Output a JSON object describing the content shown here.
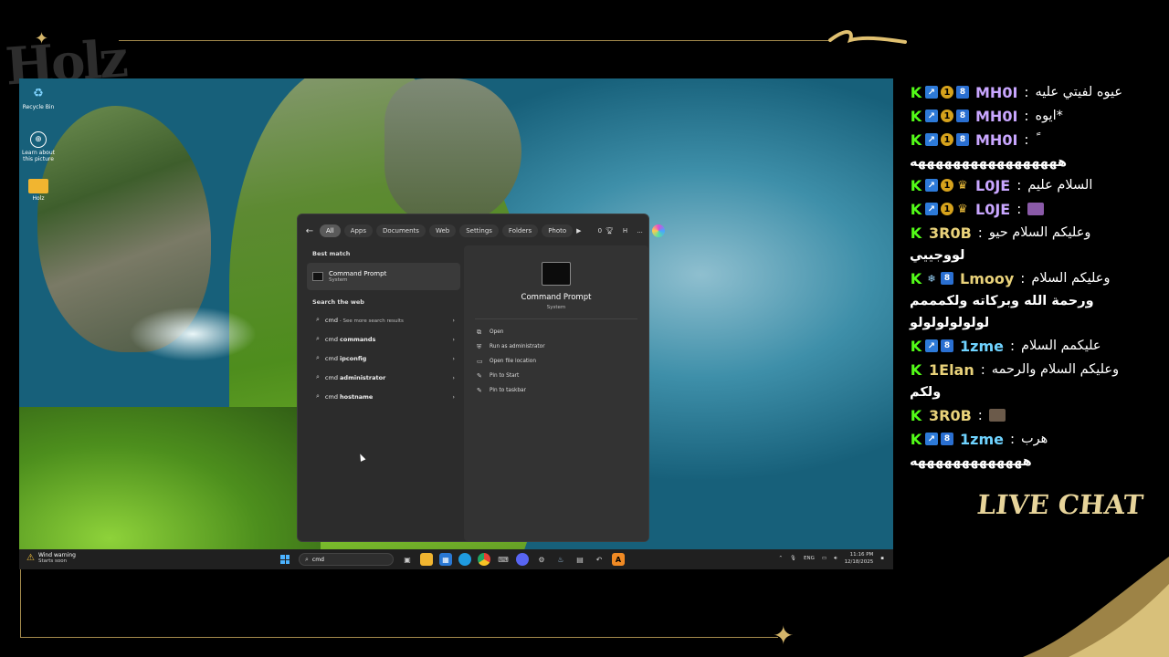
{
  "overlay": {
    "logo": "Holz",
    "live_chat": "LIVE CHAT"
  },
  "desktop": {
    "icons": [
      {
        "label": "Recycle Bin",
        "icon": "recycle-bin-icon"
      },
      {
        "label": "Learn about this picture",
        "icon": "camera-icon"
      },
      {
        "label": "Holz",
        "icon": "folder-icon"
      }
    ]
  },
  "search_panel": {
    "filters": [
      "All",
      "Apps",
      "Documents",
      "Web",
      "Settings",
      "Folders",
      "Photo"
    ],
    "filters_extra": {
      "score": "0",
      "user": "H",
      "more": "..."
    },
    "best_match_label": "Best match",
    "best_match": {
      "title": "Command Prompt",
      "subtitle": "System"
    },
    "search_web_label": "Search the web",
    "web_results": [
      {
        "prefix": "cmd",
        "bold": "",
        "suffix": " - See more search results"
      },
      {
        "prefix": "cmd ",
        "bold": "commands",
        "suffix": ""
      },
      {
        "prefix": "cmd ",
        "bold": "ipconfig",
        "suffix": ""
      },
      {
        "prefix": "cmd ",
        "bold": "administrator",
        "suffix": ""
      },
      {
        "prefix": "cmd ",
        "bold": "hostname",
        "suffix": ""
      }
    ],
    "detail": {
      "title": "Command Prompt",
      "subtitle": "System",
      "actions": [
        {
          "label": "Open",
          "icon": "open-icon"
        },
        {
          "label": "Run as administrator",
          "icon": "shield-icon"
        },
        {
          "label": "Open file location",
          "icon": "folder-icon"
        },
        {
          "label": "Pin to Start",
          "icon": "pin-icon"
        },
        {
          "label": "Pin to taskbar",
          "icon": "pin-icon"
        }
      ]
    }
  },
  "taskbar": {
    "weather_title": "Wind warning",
    "weather_sub": "Starts soon",
    "search_value": "cmd",
    "lang": "ENG",
    "time": "11:16 PM",
    "date": "12/18/2025"
  },
  "chat": {
    "messages": [
      {
        "name": "MH0I",
        "text": "عيوه لفيتي عليه",
        "cont": "",
        "badges": [
          "kick",
          "arrow",
          "one",
          "eight"
        ],
        "name_color": "#c9a6ff"
      },
      {
        "name": "MH0I",
        "text": "ايوه*",
        "cont": "",
        "badges": [
          "kick",
          "arrow",
          "one",
          "eight"
        ],
        "name_color": "#c9a6ff"
      },
      {
        "name": "MH0I",
        "text": "ً",
        "cont": "هههههههههههههههههه",
        "badges": [
          "kick",
          "arrow",
          "one",
          "eight"
        ],
        "name_color": "#c9a6ff"
      },
      {
        "name": "L0JE",
        "text": "السلام عليم",
        "cont": "",
        "badges": [
          "kick",
          "arrow",
          "one",
          "crown"
        ],
        "name_color": "#c9a6ff"
      },
      {
        "name": "L0JE",
        "text": "",
        "cont": "",
        "badges": [
          "kick",
          "arrow",
          "one",
          "crown"
        ],
        "name_color": "#c9a6ff",
        "emote": "#8a5aa8"
      },
      {
        "name": "3R0B",
        "text": "وعليكم السلام حيو",
        "cont": "لووجييي",
        "badges": [
          "kick"
        ],
        "name_color": "#e9d27a"
      },
      {
        "name": "Lmooy",
        "text": "وعليكم السلام",
        "cont": "ورحمة الله وبركاته ولكمممم",
        "cont2": "لولولولولولو",
        "badges": [
          "kick",
          "snow",
          "eight"
        ],
        "name_color": "#e9d27a"
      },
      {
        "name": "1zme",
        "text": "عليكمم السلام",
        "cont": "",
        "badges": [
          "kick",
          "arrow",
          "eight"
        ],
        "name_color": "#6fd3ff"
      },
      {
        "name": "1Elan",
        "text": "وعليكم السلام والرحمه",
        "cont": "ولكم",
        "badges": [
          "kick"
        ],
        "name_color": "#e9d27a"
      },
      {
        "name": "3R0B",
        "text": "",
        "cont": "",
        "badges": [
          "kick"
        ],
        "name_color": "#e9d27a",
        "emote": "#6b5a4a"
      },
      {
        "name": "1zme",
        "text": "هرب",
        "cont": "هههههههههههههه",
        "badges": [
          "kick",
          "arrow",
          "eight"
        ],
        "name_color": "#6fd3ff"
      }
    ]
  }
}
